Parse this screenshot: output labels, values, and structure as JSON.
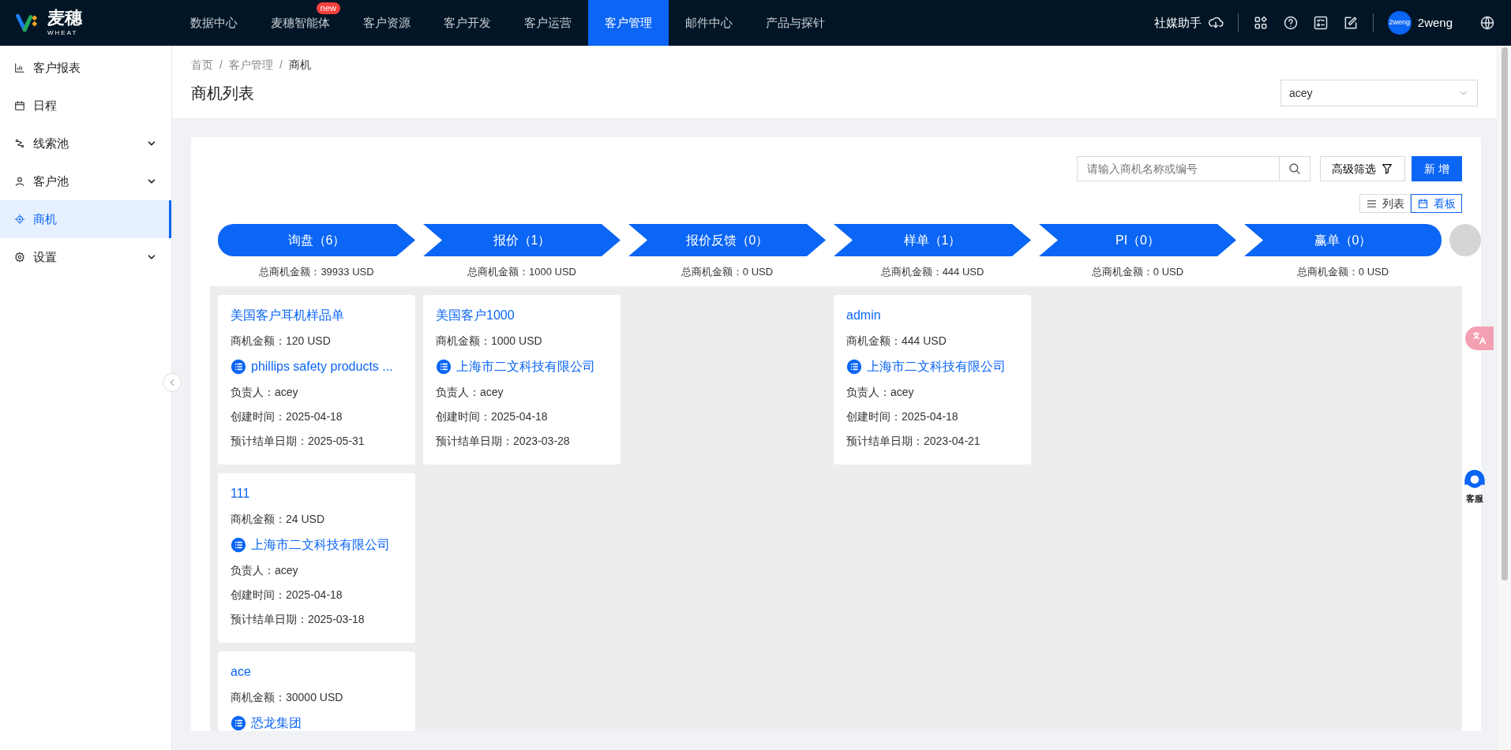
{
  "brand": {
    "name": "麦穗",
    "sub": "WHEAT"
  },
  "top_nav": [
    {
      "label": "数据中心",
      "selected": false
    },
    {
      "label": "麦穗智能体",
      "selected": false,
      "badge": "new"
    },
    {
      "label": "客户资源",
      "selected": false
    },
    {
      "label": "客户开发",
      "selected": false
    },
    {
      "label": "客户运营",
      "selected": false
    },
    {
      "label": "客户管理",
      "selected": true
    },
    {
      "label": "邮件中心",
      "selected": false
    },
    {
      "label": "产品与探针",
      "selected": false
    }
  ],
  "top_right": {
    "social": "社媒助手",
    "avatar_text": "2weng",
    "user": "2weng"
  },
  "sidebar": [
    {
      "label": "客户报表",
      "expandable": false,
      "selected": false
    },
    {
      "label": "日程",
      "expandable": false,
      "selected": false
    },
    {
      "label": "线索池",
      "expandable": true,
      "selected": false
    },
    {
      "label": "客户池",
      "expandable": true,
      "selected": false
    },
    {
      "label": "商机",
      "expandable": false,
      "selected": true
    },
    {
      "label": "设置",
      "expandable": true,
      "selected": false
    }
  ],
  "breadcrumb": [
    {
      "label": "首页",
      "separator": "/"
    },
    {
      "label": "客户管理",
      "separator": "/"
    },
    {
      "label": "商机"
    }
  ],
  "page_title": "商机列表",
  "owner_select": {
    "value": "acey"
  },
  "search": {
    "placeholder": "请输入商机名称或编号"
  },
  "filter_button": "高级筛选",
  "add_button": "新 增",
  "views": [
    {
      "label": "列表",
      "kind": "list",
      "selected": false
    },
    {
      "label": "看板",
      "kind": "board",
      "selected": true
    }
  ],
  "stages": [
    {
      "label": "询盘（6）",
      "total": "总商机金额：39933 USD",
      "cards": [
        {
          "title": "美国客户耳机样品单",
          "amount": "商机金额：120 USD",
          "customer": "phillips safety products ...",
          "owner": "负责人：acey",
          "created": "创建时间：2025-04-18",
          "close": "预计结单日期：2025-05-31"
        },
        {
          "title": "111",
          "amount": "商机金额：24 USD",
          "customer": "上海市二文科技有限公司",
          "owner": "负责人：acey",
          "created": "创建时间：2025-04-18",
          "close": "预计结单日期：2025-03-18"
        },
        {
          "title": "ace",
          "amount": "商机金额：30000 USD",
          "customer": "恐龙集团"
        }
      ]
    },
    {
      "label": "报价（1）",
      "total": "总商机金额：1000 USD",
      "cards": [
        {
          "title": "美国客户1000",
          "amount": "商机金额：1000 USD",
          "customer": "上海市二文科技有限公司",
          "owner": "负责人：acey",
          "created": "创建时间：2025-04-18",
          "close": "预计结单日期：2023-03-28"
        }
      ]
    },
    {
      "label": "报价反馈（0）",
      "total": "总商机金额：0 USD"
    },
    {
      "label": "样单（1）",
      "total": "总商机金额：444 USD",
      "cards": [
        {
          "title": "admin",
          "amount": "商机金额：444 USD",
          "customer": "上海市二文科技有限公司",
          "owner": "负责人：acey",
          "created": "创建时间：2025-04-18",
          "close": "预计结单日期：2023-04-21"
        }
      ]
    },
    {
      "label": "PI（0）",
      "total": "总商机金额：0 USD"
    },
    {
      "label": "赢单（0）",
      "total": "总商机金额：0 USD"
    }
  ],
  "service_label": "客服"
}
